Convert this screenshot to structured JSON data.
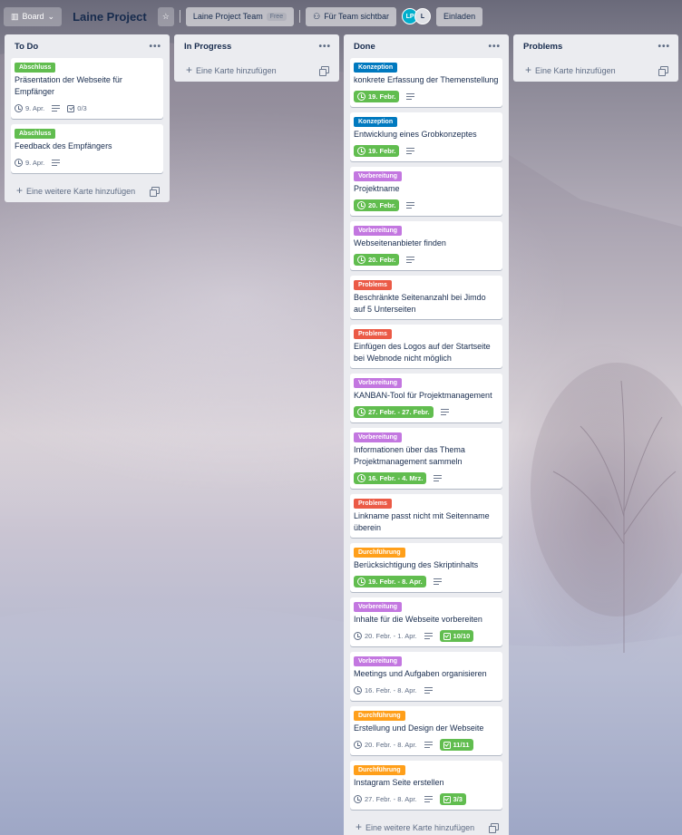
{
  "header": {
    "board_button": "Board",
    "board_title": "Laine Project",
    "team_button": "Laine Project Team",
    "free_badge": "Free",
    "visibility_button": "Für Team sichtbar",
    "avatars": [
      "LP",
      "L"
    ],
    "invite_button": "Einladen"
  },
  "colors": {
    "green": "#61bd4f",
    "blue": "#0079bf",
    "purple": "#c377e0",
    "red": "#eb5a46",
    "orange": "#ff9f1a",
    "list_bg": "#ebecf0"
  },
  "lists": [
    {
      "title": "To Do",
      "add_label": "Eine weitere Karte hinzufügen",
      "cards": [
        {
          "label": "Abschluss",
          "label_color": "green",
          "title": "Präsentation der Webseite für Empfänger",
          "date": "9. Apr.",
          "date_done": false,
          "desc": true,
          "checklist": "0/3",
          "checklist_done": false
        },
        {
          "label": "Abschluss",
          "label_color": "green",
          "title": "Feedback des Empfängers",
          "date": "9. Apr.",
          "date_done": false,
          "desc": true
        }
      ]
    },
    {
      "title": "In Progress",
      "add_label": "Eine Karte hinzufügen",
      "cards": []
    },
    {
      "title": "Done",
      "add_label": "Eine weitere Karte hinzufügen",
      "cards": [
        {
          "label": "Konzeption",
          "label_color": "blue",
          "title": "konkrete Erfassung der Themenstellung",
          "date": "19. Febr.",
          "date_done": true,
          "desc": true
        },
        {
          "label": "Konzeption",
          "label_color": "blue",
          "title": "Entwicklung eines Grobkonzeptes",
          "date": "19. Febr.",
          "date_done": true,
          "desc": true
        },
        {
          "label": "Vorbereitung",
          "label_color": "purple",
          "title": "Projektname",
          "date": "20. Febr.",
          "date_done": true,
          "desc": true
        },
        {
          "label": "Vorbereitung",
          "label_color": "purple",
          "title": "Webseitenanbieter finden",
          "date": "20. Febr.",
          "date_done": true,
          "desc": true
        },
        {
          "label": "Problems",
          "label_color": "red",
          "title": "Beschränkte Seitenanzahl bei Jimdo auf 5 Unterseiten"
        },
        {
          "label": "Problems",
          "label_color": "red",
          "title": "Einfügen des Logos auf der Startseite bei Webnode nicht möglich"
        },
        {
          "label": "Vorbereitung",
          "label_color": "purple",
          "title": "KANBAN-Tool für Projektmanagement",
          "date": "27. Febr. - 27. Febr.",
          "date_done": true,
          "desc": true
        },
        {
          "label": "Vorbereitung",
          "label_color": "purple",
          "title": "Informationen über das Thema Projektmanagement sammeln",
          "date": "16. Febr. - 4. Mrz.",
          "date_done": true,
          "desc": true
        },
        {
          "label": "Problems",
          "label_color": "red",
          "title": "Linkname passt nicht mit Seitenname überein"
        },
        {
          "label": "Durchführung",
          "label_color": "orange",
          "title": "Berücksichtigung des Skriptinhalts",
          "date": "19. Febr. - 8. Apr.",
          "date_done": true,
          "desc": true
        },
        {
          "label": "Vorbereitung",
          "label_color": "purple",
          "title": "Inhalte für die Webseite vorbereiten",
          "date": "20. Febr. - 1. Apr.",
          "date_done": false,
          "desc": true,
          "checklist": "10/10",
          "checklist_done": true
        },
        {
          "label": "Vorbereitung",
          "label_color": "purple",
          "title": "Meetings und Aufgaben organisieren",
          "date": "16. Febr. - 8. Apr.",
          "date_done": false,
          "desc": true
        },
        {
          "label": "Durchführung",
          "label_color": "orange",
          "title": "Erstellung und Design der Webseite",
          "date": "20. Febr. - 8. Apr.",
          "date_done": false,
          "desc": true,
          "checklist": "11/11",
          "checklist_done": true
        },
        {
          "label": "Durchführung",
          "label_color": "orange",
          "title": "Instagram Seite erstellen",
          "date": "27. Febr. - 8. Apr.",
          "date_done": false,
          "desc": true,
          "checklist": "3/3",
          "checklist_done": true
        }
      ]
    },
    {
      "title": "Problems",
      "add_label": "Eine Karte hinzufügen",
      "cards": []
    }
  ]
}
